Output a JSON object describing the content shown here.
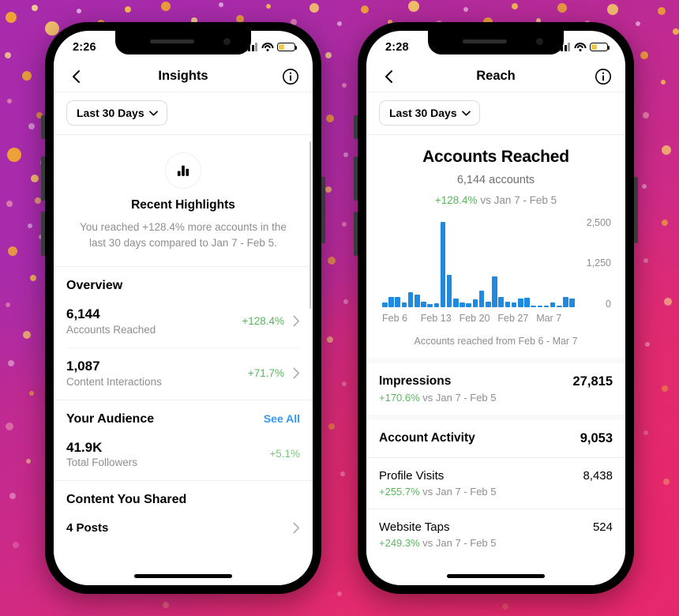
{
  "background": {
    "gradient_from": "#a32ba8",
    "gradient_to": "#e8285f",
    "confetti_colors": [
      "#f0a830",
      "#f7c948",
      "#e8913a",
      "#f5d98b",
      "#ef7d9c",
      "#ffffff"
    ]
  },
  "accent": {
    "green": "#58b85c",
    "blue_link": "#3797f0",
    "bar_blue": "#1f8ae0"
  },
  "phones": [
    {
      "id": "insights-phone",
      "status_bar": {
        "time": "2:26",
        "signal": "cellular-signal-icon",
        "wifi": "wifi-icon",
        "battery": "battery-low-icon"
      },
      "nav": {
        "back": "back-chevron-icon",
        "title": "Insights",
        "info": "info-circle-icon"
      },
      "filter": {
        "label": "Last 30 Days",
        "chevron": "chevron-down-icon"
      },
      "highlight": {
        "icon": "bar-chart-icon",
        "title": "Recent Highlights",
        "description": "You reached +128.4% more accounts in the last 30 days compared to Jan 7 - Feb 5."
      },
      "overview": {
        "title": "Overview",
        "rows": [
          {
            "value": "6,144",
            "label": "Accounts Reached",
            "delta": "+128.4%",
            "chevron": "chevron-right-icon"
          },
          {
            "value": "1,087",
            "label": "Content Interactions",
            "delta": "+71.7%",
            "chevron": "chevron-right-icon"
          }
        ]
      },
      "audience": {
        "title": "Your Audience",
        "see_all": "See All",
        "rows": [
          {
            "value": "41.9K",
            "label": "Total Followers",
            "delta": "+5.1%"
          }
        ]
      },
      "content_shared": {
        "title": "Content You Shared",
        "rows": [
          {
            "label": "4 Posts",
            "chevron": "chevron-right-icon"
          }
        ]
      }
    },
    {
      "id": "reach-phone",
      "status_bar": {
        "time": "2:28",
        "signal": "cellular-signal-icon",
        "wifi": "wifi-icon",
        "battery": "battery-low-icon"
      },
      "nav": {
        "back": "back-chevron-icon",
        "title": "Reach",
        "info": "info-circle-icon"
      },
      "filter": {
        "label": "Last 30 Days",
        "chevron": "chevron-down-icon"
      },
      "reach_card": {
        "title": "Accounts Reached",
        "subtitle": "6,144 accounts",
        "delta": "+128.4%",
        "delta_suffix": " vs Jan 7 - Feb 5",
        "note": "Accounts reached from Feb 6 - Mar 7"
      },
      "stats": [
        {
          "name": "Impressions",
          "value": "27,815",
          "delta": "+170.6%",
          "delta_suffix": " vs Jan 7 - Feb 5",
          "bold": true,
          "big_value": true
        },
        {
          "name": "Account Activity",
          "value": "9,053",
          "delta": "",
          "delta_suffix": "",
          "bold": true,
          "big_value": true
        },
        {
          "name": "Profile Visits",
          "value": "8,438",
          "delta": "+255.7%",
          "delta_suffix": " vs Jan 7 - Feb 5",
          "bold": false,
          "big_value": false
        },
        {
          "name": "Website Taps",
          "value": "524",
          "delta": "+249.3%",
          "delta_suffix": " vs Jan 7 - Feb 5",
          "bold": false,
          "big_value": false
        }
      ]
    }
  ],
  "chart_data": {
    "type": "bar",
    "title": "Accounts Reached",
    "xlabel": "",
    "ylabel": "",
    "ylim": [
      0,
      2500
    ],
    "yticks": [
      0,
      1250,
      2500
    ],
    "ytick_labels": [
      "0",
      "1,250",
      "2,500"
    ],
    "grid": false,
    "legend": null,
    "annotation": "Accounts reached from Feb 6 - Mar 7",
    "tick_labels": [
      "Feb 6",
      "Feb 13",
      "Feb 20",
      "Feb 27",
      "Mar 7"
    ],
    "categories": [
      "Feb 6",
      "Feb 7",
      "Feb 8",
      "Feb 9",
      "Feb 10",
      "Feb 11",
      "Feb 12",
      "Feb 13",
      "Feb 14",
      "Feb 15",
      "Feb 16",
      "Feb 17",
      "Feb 18",
      "Feb 19",
      "Feb 20",
      "Feb 21",
      "Feb 22",
      "Feb 23",
      "Feb 24",
      "Feb 25",
      "Feb 26",
      "Feb 27",
      "Feb 28",
      "Mar 1",
      "Mar 2",
      "Mar 3",
      "Mar 4",
      "Mar 5",
      "Mar 6",
      "Mar 7"
    ],
    "values": [
      150,
      310,
      300,
      130,
      440,
      380,
      170,
      90,
      120,
      2500,
      960,
      260,
      140,
      120,
      230,
      480,
      160,
      900,
      300,
      160,
      130,
      250,
      280,
      25,
      25,
      25,
      150,
      40,
      300,
      260
    ]
  }
}
